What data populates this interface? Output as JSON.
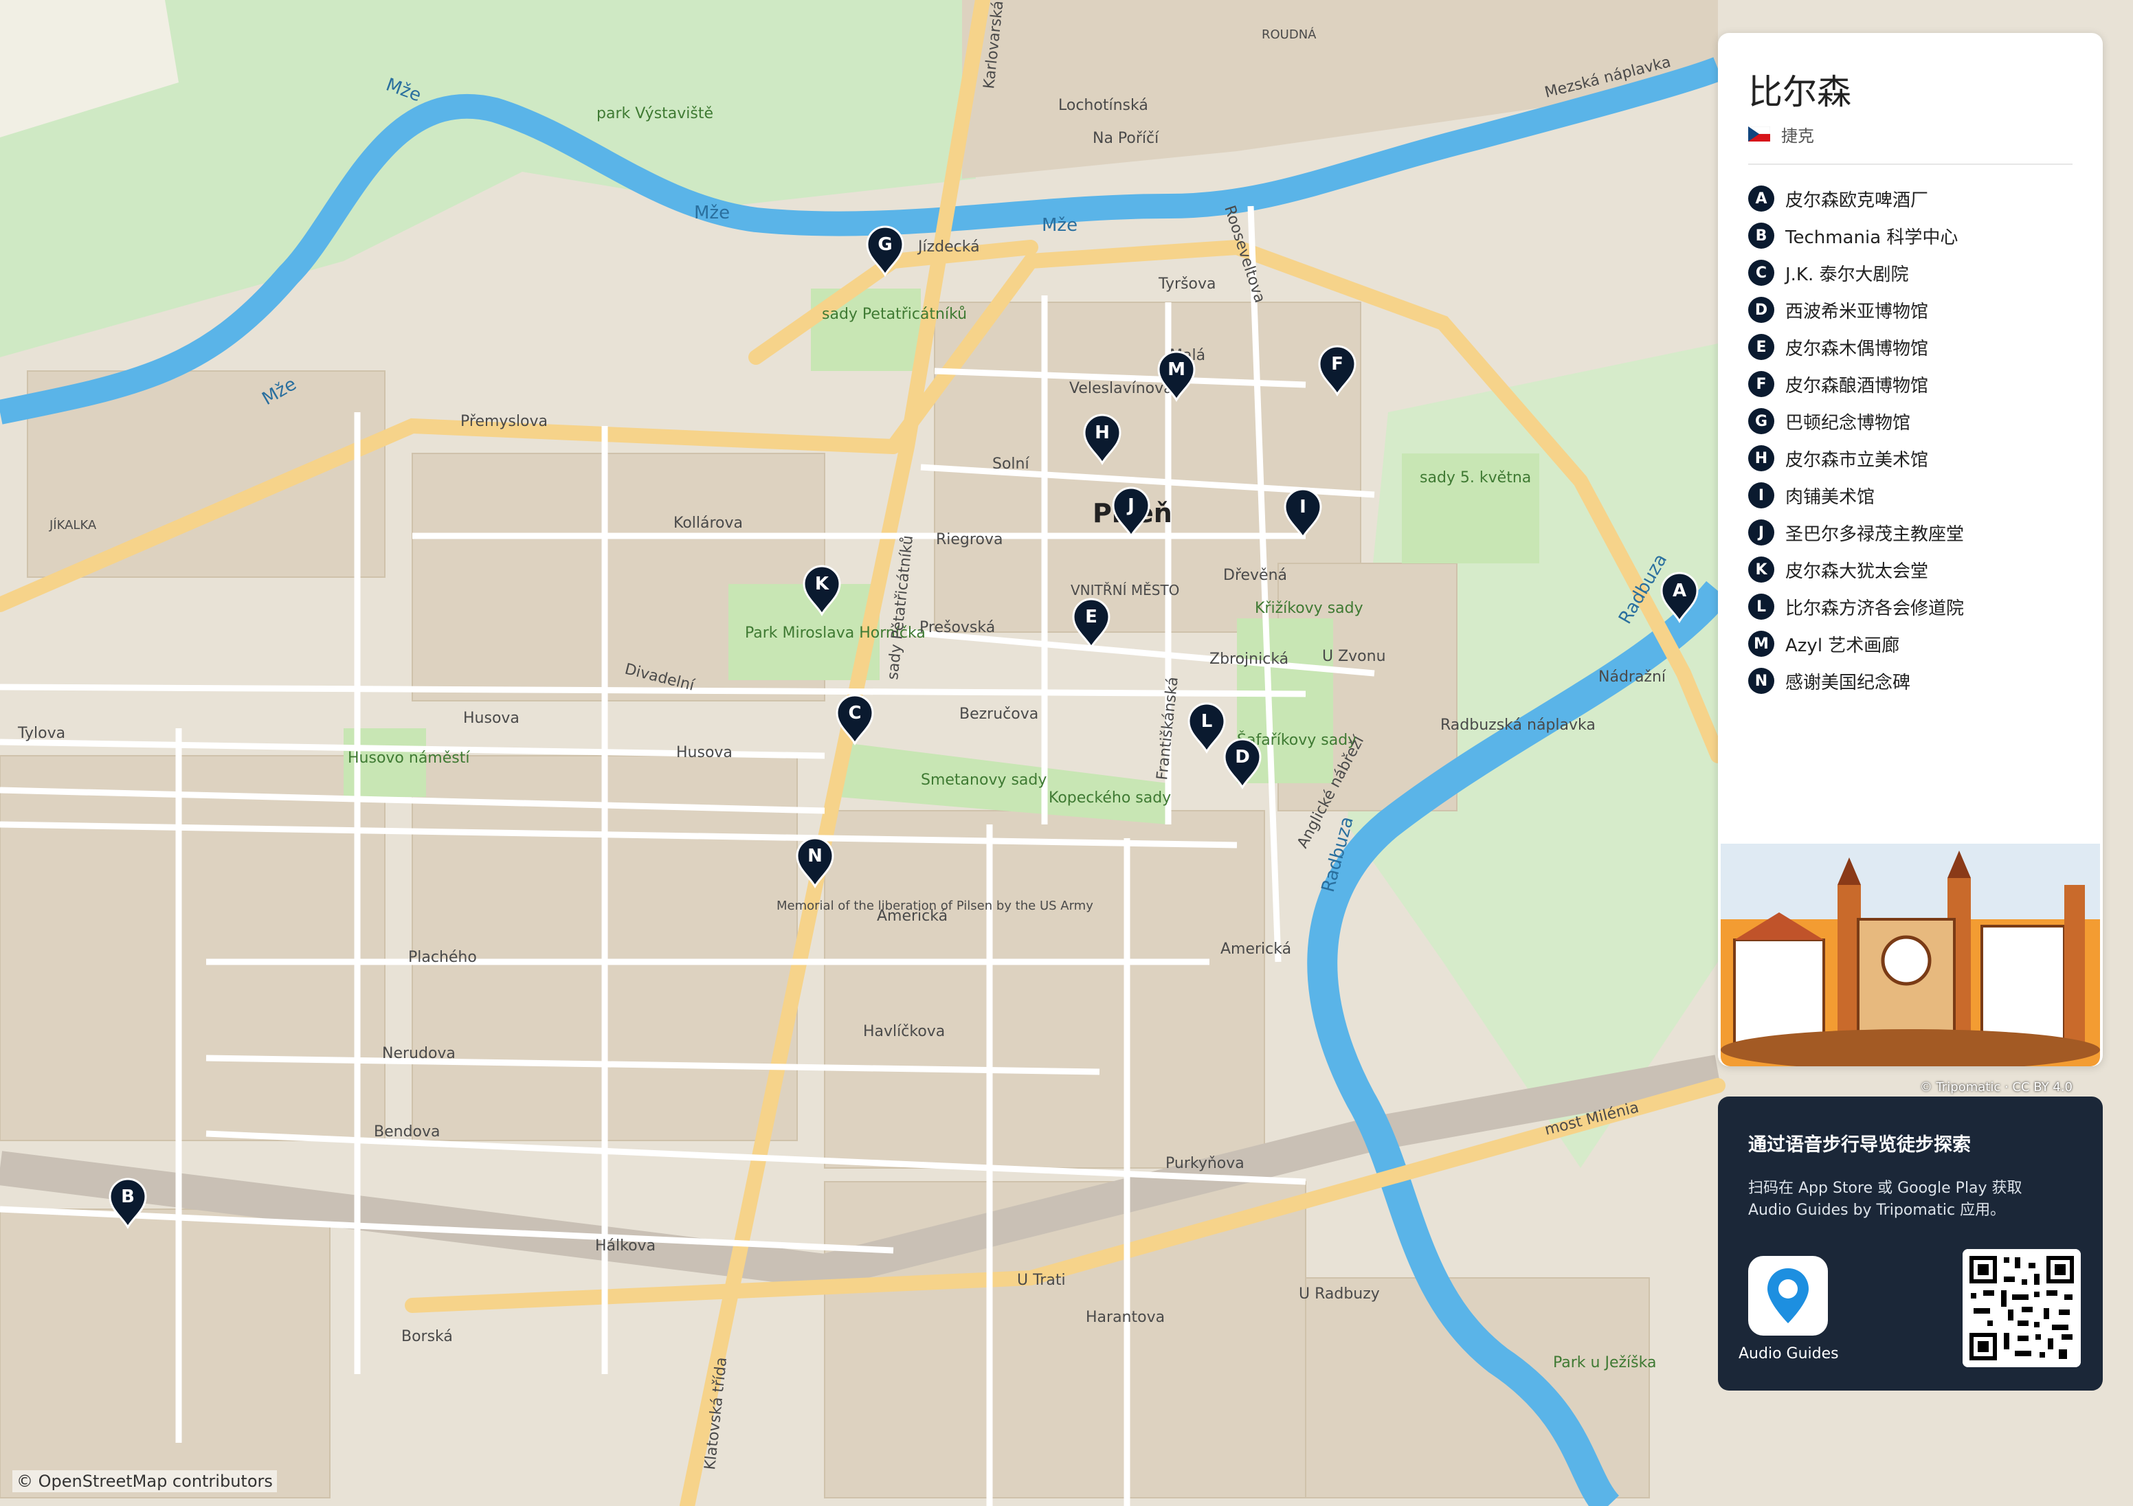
{
  "city": "比尔森",
  "country": "捷克",
  "pois": [
    {
      "letter": "A",
      "name": "皮尔森欧克啤酒厂"
    },
    {
      "letter": "B",
      "name": "Techmania 科学中心"
    },
    {
      "letter": "C",
      "name": "J.K. 泰尔大剧院"
    },
    {
      "letter": "D",
      "name": "西波希米亚博物馆"
    },
    {
      "letter": "E",
      "name": "皮尔森木偶博物馆"
    },
    {
      "letter": "F",
      "name": "皮尔森酿酒博物馆"
    },
    {
      "letter": "G",
      "name": "巴顿纪念博物馆"
    },
    {
      "letter": "H",
      "name": "皮尔森市立美术馆"
    },
    {
      "letter": "I",
      "name": "肉铺美术馆"
    },
    {
      "letter": "J",
      "name": "圣巴尔多禄茂主教座堂"
    },
    {
      "letter": "K",
      "name": "皮尔森大犹太会堂"
    },
    {
      "letter": "L",
      "name": "比尔森方济各会修道院"
    },
    {
      "letter": "M",
      "name": "Azyl 艺术画廊"
    },
    {
      "letter": "N",
      "name": "感谢美国纪念碑"
    }
  ],
  "illustration_credit": "© Tripomatic · CC BY 4.0",
  "audio": {
    "title": "通过语音步行导览徒步探索",
    "text": "扫码在 App Store 或 Google Play 获取 Audio Guides by Tripomatic 应用。",
    "app_label": "Audio Guides"
  },
  "map_attribution": "© OpenStreetMap contributors",
  "colors": {
    "marker": "#0a1a2f",
    "water": "#5ab4e8",
    "park": "#c8e6b4",
    "road_major": "#f6d38a",
    "block": "#ddd2c0"
  },
  "map_labels": {
    "city_label": "Plzeň",
    "district": "VNITŘNÍ MĚSTO",
    "roudna": "ROUDNÁ",
    "jikalka": "JÍKALKA",
    "mze1": "Mže",
    "mze2": "Mže",
    "mze3": "Mže",
    "mze4": "Mže",
    "radbuza1": "Radbuza",
    "radbuza2": "Radbuza",
    "park_vystaviste": "park Výstaviště",
    "sady_petat": "sady Petatřicátníků",
    "sady5kvetna": "sady 5. května",
    "krizikovy": "Křižíkovy sady",
    "safarikovy": "Šafaříkovy sady",
    "smetanovy": "Smetanovy sady",
    "kopeckeho": "Kopeckého sady",
    "park_hornicka": "Park Miroslava Horníčka",
    "husovo": "Husovo náměstí",
    "park_jezis": "Park u Ježíška",
    "memorial": "Memorial of the liberation of Pilsen by the US Army",
    "premyslova": "Přemyslova",
    "kollarova": "Kollárova",
    "solni": "Solní",
    "riegrova": "Riegrova",
    "presovska": "Prešovská",
    "zbrojnicka": "Zbrojnická",
    "bezrucova": "Bezručova",
    "husova": "Husova",
    "tylova": "Tylova",
    "americka": "Americká",
    "havlickova": "Havlíčkova",
    "nerudova": "Nerudova",
    "bendova": "Bendova",
    "halkova": "Hálkova",
    "u_trati": "U Trati",
    "borska": "Borská",
    "jizdecka": "Jízdecká",
    "veleslavinova": "Veleslavínova",
    "mala": "Malá",
    "tyrsova": "Tyršova",
    "drevena": "Dřevěná",
    "u_zvonu": "U Zvonu",
    "nadrazni": "Nádražní",
    "most_milenia": "most Milénia",
    "mezska": "Mezská náplavka",
    "radbuzska": "Radbuzská náplavka",
    "klatovska": "Klatovská třída",
    "rooseveltova": "Rooseveltova",
    "frantiskanska": "Františkánská",
    "sady_petat_street": "sady Pětatřicátníků",
    "divadelni": "Divadelní",
    "plachého": "Plachého",
    "puklova": "Purkyňova",
    "harantova": "Harantova",
    "slovanska": "U Radbuzy",
    "karlovarska": "Karlovarská",
    "lochotinska": "Lochotínská",
    "na_porici": "Na Poříčí",
    "anglicke": "Anglické nábřeží"
  }
}
